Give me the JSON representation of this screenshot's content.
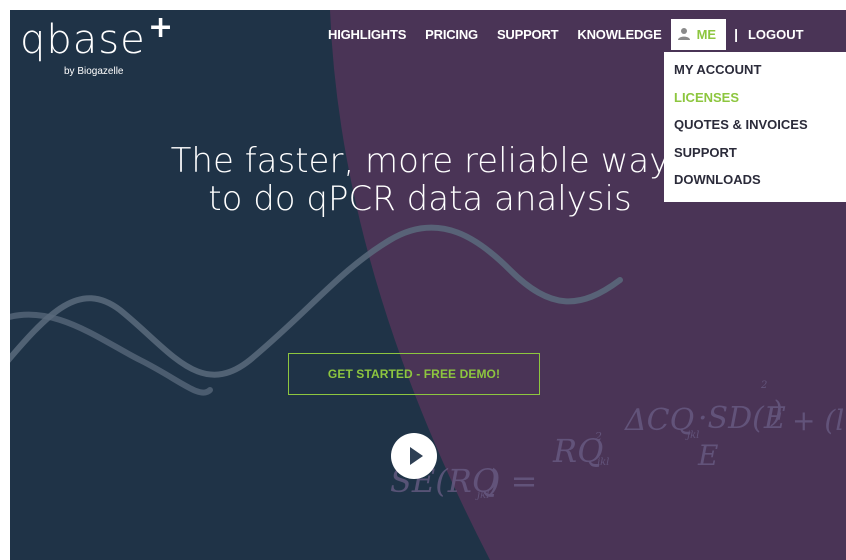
{
  "brand": {
    "logo_text": "qbase",
    "logo_plus": "+",
    "tagline": "by Biogazelle"
  },
  "nav": {
    "items": [
      "HIGHLIGHTS",
      "PRICING",
      "SUPPORT",
      "KNOWLEDGE"
    ],
    "me_label": "ME",
    "separator": "|",
    "logout_label": "LOGOUT"
  },
  "user_menu": {
    "items": [
      "MY ACCOUNT",
      "LICENSES",
      "QUOTES & INVOICES",
      "SUPPORT",
      "DOWNLOADS"
    ],
    "active_index": 1
  },
  "hero": {
    "headline_line1": "The faster, more reliable way",
    "headline_line2": "to do qPCR data analysis",
    "cta_label": "GET STARTED - FREE DEMO!",
    "play_icon": "play-icon"
  },
  "colors": {
    "navy": "#1f3347",
    "purple": "#4a3456",
    "accent_green": "#8dc63f",
    "white": "#ffffff"
  }
}
